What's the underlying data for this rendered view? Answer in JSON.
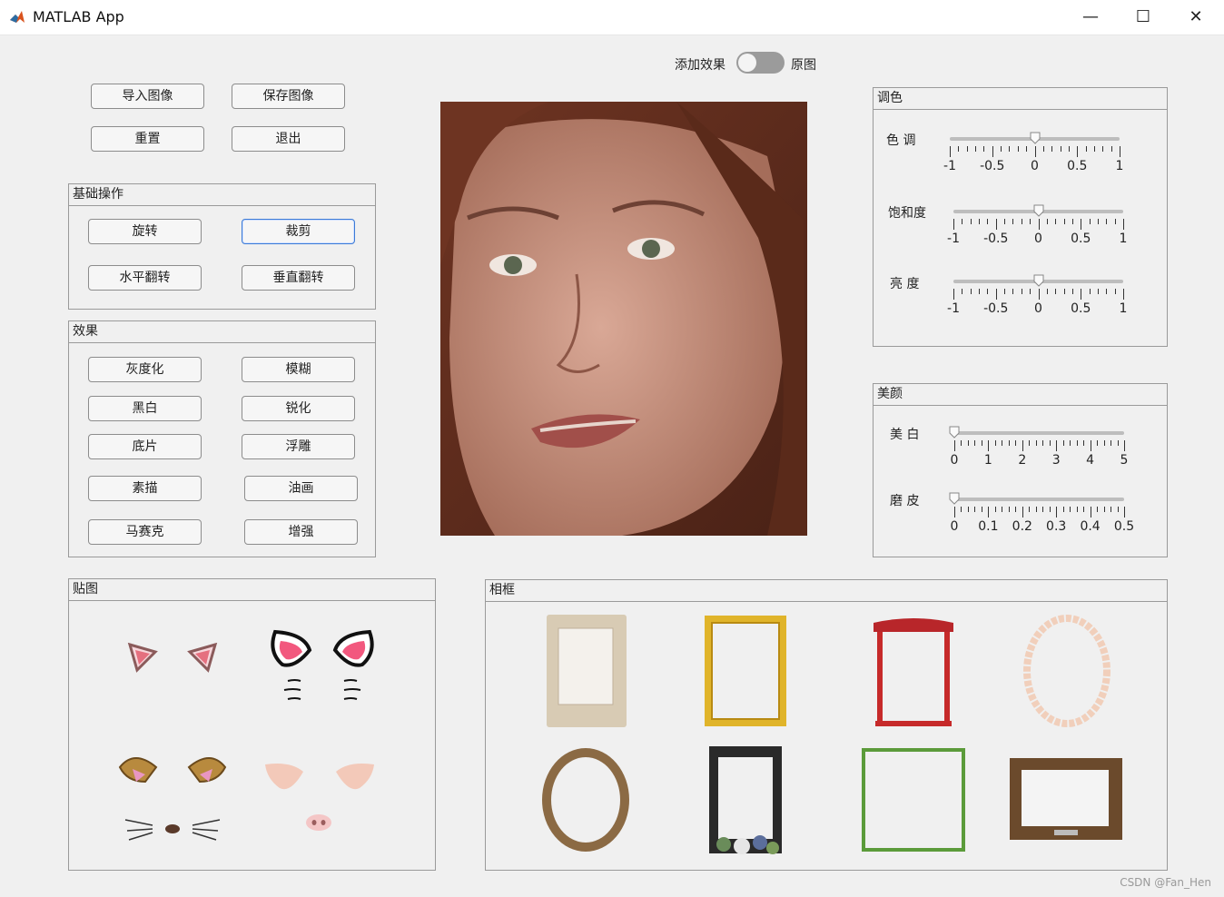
{
  "window": {
    "title": "MATLAB App",
    "minimize_glyph": "—",
    "maximize_glyph": "☐",
    "close_glyph": "✕"
  },
  "toggle": {
    "left_label": "添加效果",
    "right_label": "原图",
    "state": "off"
  },
  "top_buttons": {
    "import": "导入图像",
    "save": "保存图像",
    "reset": "重置",
    "exit": "退出"
  },
  "basic_ops": {
    "title": "基础操作",
    "rotate": "旋转",
    "crop": "裁剪",
    "hflip": "水平翻转",
    "vflip": "垂直翻转"
  },
  "effects": {
    "title": "效果",
    "grayscale": "灰度化",
    "blur": "模糊",
    "bw": "黑白",
    "sharpen": "锐化",
    "negative": "底片",
    "emboss": "浮雕",
    "sketch": "素描",
    "oil": "油画",
    "mosaic": "马赛克",
    "enhance": "增强"
  },
  "color_adjust": {
    "title": "调色",
    "hue": {
      "label": "色  调",
      "value": 0,
      "ticks": [
        "-1",
        "-0.5",
        "0",
        "0.5",
        "1"
      ]
    },
    "saturation": {
      "label": "饱和度",
      "value": 0,
      "ticks": [
        "-1",
        "-0.5",
        "0",
        "0.5",
        "1"
      ]
    },
    "brightness": {
      "label": "亮  度",
      "value": 0,
      "ticks": [
        "-1",
        "-0.5",
        "0",
        "0.5",
        "1"
      ]
    }
  },
  "beauty": {
    "title": "美颜",
    "whiten": {
      "label": "美  白",
      "value": 0,
      "ticks": [
        "0",
        "1",
        "2",
        "3",
        "4",
        "5"
      ]
    },
    "smooth": {
      "label": "磨  皮",
      "value": 0,
      "ticks": [
        "0",
        "0.1",
        "0.2",
        "0.3",
        "0.4",
        "0.5"
      ]
    }
  },
  "stickers": {
    "title": "贴图",
    "items": [
      "small-pink-ears-sticker",
      "cat-ears-whiskers-sticker",
      "dog-ears-whiskers-sticker",
      "pig-ears-nose-sticker"
    ]
  },
  "frames": {
    "title": "相框",
    "items": [
      "vintage-paper-frame",
      "gold-ornate-frame",
      "red-roof-frame",
      "pink-scalloped-oval-frame",
      "bronze-oval-frame",
      "black-floral-frame",
      "bamboo-frame",
      "wood-frame"
    ]
  },
  "watermark": "CSDN @Fan_Hen",
  "colors": {
    "window_bg": "#f0f0f0",
    "toggle_bg": "#9b9b9b",
    "focus_border": "#3c7ad6"
  }
}
